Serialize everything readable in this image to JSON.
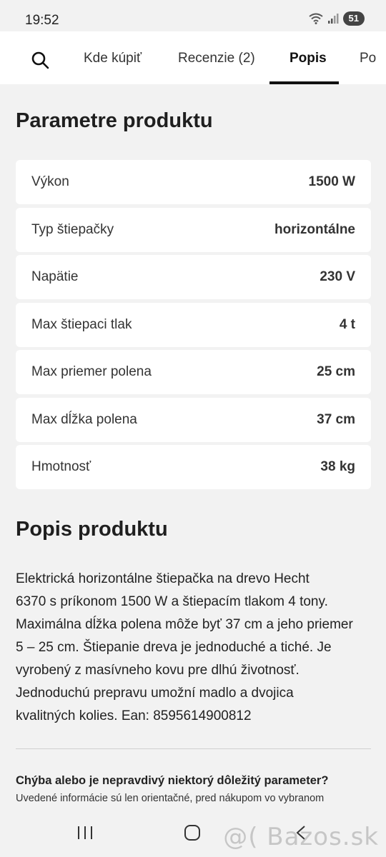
{
  "status_bar": {
    "time": "19:52",
    "battery": "51"
  },
  "tabs": [
    {
      "label": "Kde kúpiť"
    },
    {
      "label": "Recenzie (2)"
    },
    {
      "label": "Popis"
    },
    {
      "label": "Po"
    }
  ],
  "parameters": {
    "title": "Parametre produktu",
    "rows": [
      {
        "label": "Výkon",
        "value": "1500 W"
      },
      {
        "label": "Typ štiepačky",
        "value": "horizontálne"
      },
      {
        "label": "Napätie",
        "value": "230 V"
      },
      {
        "label": "Max štiepaci tlak",
        "value": "4 t"
      },
      {
        "label": "Max priemer polena",
        "value": "25 cm"
      },
      {
        "label": "Max dĺžka polena",
        "value": "37 cm"
      },
      {
        "label": "Hmotnosť",
        "value": "38 kg"
      }
    ]
  },
  "description": {
    "title": "Popis produktu",
    "lines": [
      "Elektrická horizontálne štiepačka na drevo Hecht",
      "6370 s príkonom 1500 W a štiepacím tlakom 4 tony.",
      "Maximálna dĺžka polena môže byť 37 cm a jeho priemer",
      "5 – 25 cm. Štiepanie dreva je jednoduché a tiché. Je",
      "vyrobený z masívneho kovu pre dlhú životnosť.",
      "Jednoduchú prepravu umožní madlo a dvojica",
      "kvalitných kolies. Ean: 8595614900812"
    ]
  },
  "feedback": {
    "title": "Chýba alebo je nepravdivý niektorý dôležitý parameter?",
    "text": "Uvedené informácie sú len orientačné, pred nákupom vo vybranom"
  },
  "watermark": "@( Bazos.sk"
}
